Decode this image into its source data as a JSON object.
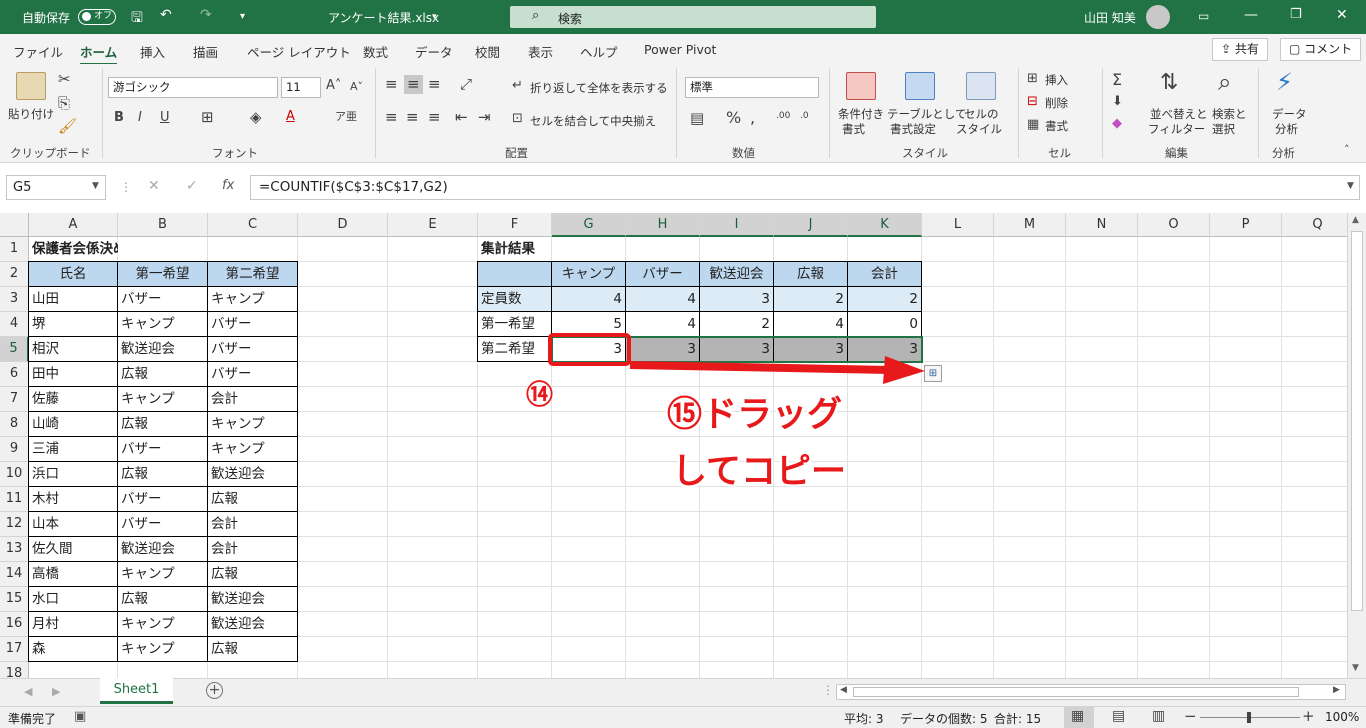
{
  "titlebar": {
    "autosave": "自動保存",
    "toggle": "オフ",
    "filename": "アンケート結果.xlsx",
    "search_placeholder": "検索",
    "user": "山田 知美"
  },
  "tabs": [
    "ファイル",
    "ホーム",
    "挿入",
    "描画",
    "ページ レイアウト",
    "数式",
    "データ",
    "校閲",
    "表示",
    "ヘルプ",
    "Power Pivot"
  ],
  "share": "共有",
  "comment": "コメント",
  "ribbon": {
    "paste": "貼り付け",
    "clipboard": "クリップボード",
    "font_name": "游ゴシック",
    "font_size": "11",
    "font_group": "フォント",
    "wrap": "折り返して全体を表示する",
    "merge": "セルを結合して中央揃え",
    "align_group": "配置",
    "numfmt": "標準",
    "number_group": "数値",
    "cond1": "条件付き",
    "cond2": "書式",
    "table1": "テーブルとして",
    "table2": "書式設定",
    "cellstyle1": "セルの",
    "cellstyle2": "スタイル",
    "style_group": "スタイル",
    "insert": "挿入",
    "delete": "削除",
    "format": "書式",
    "cells_group": "セル",
    "sort1": "並べ替えと",
    "sort2": "フィルター",
    "find1": "検索と",
    "find2": "選択",
    "edit_group": "編集",
    "analyze1": "データ",
    "analyze2": "分析",
    "analysis_group": "分析"
  },
  "formula": {
    "namebox": "G5",
    "text": "=COUNTIF($C$3:$C$17,G2)"
  },
  "columns": [
    "A",
    "B",
    "C",
    "D",
    "E",
    "F",
    "G",
    "H",
    "I",
    "J",
    "K",
    "L",
    "M",
    "N",
    "O",
    "P",
    "Q"
  ],
  "rows": [
    "1",
    "2",
    "3",
    "4",
    "5",
    "6",
    "7",
    "8",
    "9",
    "10",
    "11",
    "12",
    "13",
    "14",
    "15",
    "16",
    "17",
    "18"
  ],
  "survey": {
    "title": "保護者会係決めアンケート結果",
    "headers": [
      "氏名",
      "第一希望",
      "第二希望"
    ],
    "data": [
      [
        "山田",
        "バザー",
        "キャンプ"
      ],
      [
        "堺",
        "キャンプ",
        "バザー"
      ],
      [
        "相沢",
        "歓送迎会",
        "バザー"
      ],
      [
        "田中",
        "広報",
        "バザー"
      ],
      [
        "佐藤",
        "キャンプ",
        "会計"
      ],
      [
        "山崎",
        "広報",
        "キャンプ"
      ],
      [
        "三浦",
        "バザー",
        "キャンプ"
      ],
      [
        "浜口",
        "広報",
        "歓送迎会"
      ],
      [
        "木村",
        "バザー",
        "広報"
      ],
      [
        "山本",
        "バザー",
        "会計"
      ],
      [
        "佐久間",
        "歓送迎会",
        "会計"
      ],
      [
        "高橋",
        "キャンプ",
        "広報"
      ],
      [
        "水口",
        "広報",
        "歓送迎会"
      ],
      [
        "月村",
        "キャンプ",
        "歓送迎会"
      ],
      [
        "森",
        "キャンプ",
        "広報"
      ]
    ]
  },
  "summary": {
    "title": "集計結果",
    "headers": [
      "キャンプ",
      "バザー",
      "歓送迎会",
      "広報",
      "会計"
    ],
    "rows": [
      {
        "label": "定員数",
        "values": [
          "4",
          "4",
          "3",
          "2",
          "2"
        ]
      },
      {
        "label": "第一希望",
        "values": [
          "5",
          "4",
          "2",
          "4",
          "0"
        ]
      },
      {
        "label": "第二希望",
        "values": [
          "3",
          "3",
          "3",
          "3",
          "3"
        ]
      }
    ]
  },
  "annotations": {
    "step14": "⑭",
    "step15_line1": "⑮ドラッグ",
    "step15_line2": "してコピー",
    "arrow_color": "#e8191b"
  },
  "sheet_tab": "Sheet1",
  "status": {
    "ready": "準備完了",
    "average": "平均: 3",
    "count": "データの個数: 5",
    "sum": "合計: 15",
    "zoom": "100%"
  }
}
